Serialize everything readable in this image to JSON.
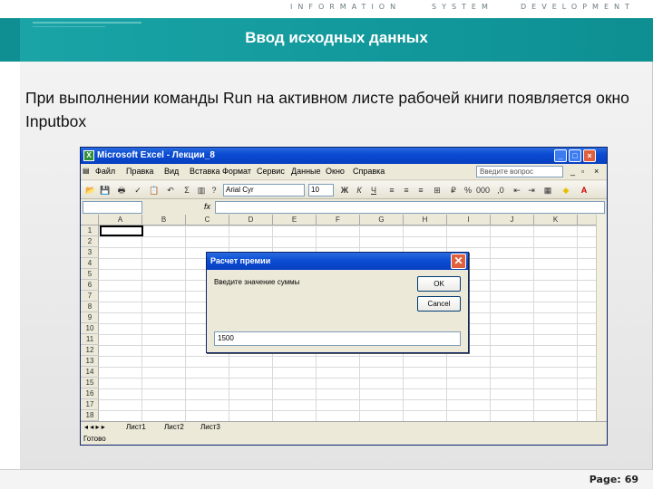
{
  "header": {
    "word1": "INFORMATION",
    "word2": "SYSTEM",
    "word3": "DEVELOPMENT",
    "title": "Ввод исходных данных"
  },
  "body_text": "При выполнении команды Run на активном листе рабочей книги появляется окно Inputbox",
  "footer": {
    "page_label": "Page:",
    "page_number": "69"
  },
  "excel": {
    "title": "Microsoft Excel - Лекции_8",
    "menu": [
      "Файл",
      "Правка",
      "Вид",
      "Вставка",
      "Формат",
      "Сервис",
      "Данные",
      "Окно",
      "Справка"
    ],
    "help_placeholder": "Введите вопрос",
    "font_name": "Arial Cyr",
    "font_size": "10",
    "columns": [
      "A",
      "B",
      "C",
      "D",
      "E",
      "F",
      "G",
      "H",
      "I",
      "J",
      "K"
    ],
    "rows": [
      "1",
      "2",
      "3",
      "4",
      "5",
      "6",
      "7",
      "8",
      "9",
      "10",
      "11",
      "12",
      "13",
      "14",
      "15",
      "16",
      "17",
      "18"
    ],
    "sheet_tabs": [
      "Лист1",
      "Лист2",
      "Лист3"
    ],
    "status": "Готово",
    "colors": {
      "titlebar": "#0a4bd2",
      "chrome": "#ece9d8"
    }
  },
  "dialog": {
    "title": "Расчет премии",
    "prompt": "Введите значение суммы",
    "ok_label": "OK",
    "cancel_label": "Cancel",
    "input_value": "1500"
  }
}
